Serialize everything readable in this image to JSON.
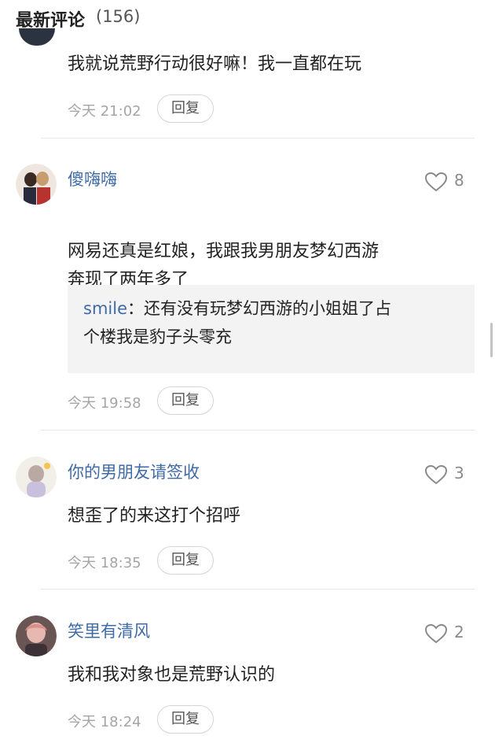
{
  "header": {
    "title": "最新评论",
    "count": "(156)"
  },
  "comments": [
    {
      "content": "我就说荒野行动很好嘛！我一直都在玩",
      "time": "今天 21:02",
      "reply_label": "回复"
    },
    {
      "username": "傻嗨嗨",
      "likes": "8",
      "content": "网易还真是红娘，我跟我男朋友梦幻西游\n奔现了两年多了",
      "emoji": "polar-bear-sticker",
      "reply": {
        "user": "smile",
        "sep": "：",
        "text": "还有没有玩梦幻西游的小姐姐了占\n个楼我是豹子头零充"
      },
      "time": "今天 19:58",
      "reply_label": "回复"
    },
    {
      "username": "你的男朋友请签收",
      "likes": "3",
      "content": "想歪了的来这打个招呼",
      "time": "今天 18:35",
      "reply_label": "回复"
    },
    {
      "username": "笑里有清风",
      "likes": "2",
      "content": "我和我对象也是荒野认识的",
      "time": "今天 18:24",
      "reply_label": "回复"
    }
  ],
  "colors": {
    "username": "#3f6aa8",
    "meta": "#a5a5a5",
    "reply_bg": "#f3f3f3"
  }
}
